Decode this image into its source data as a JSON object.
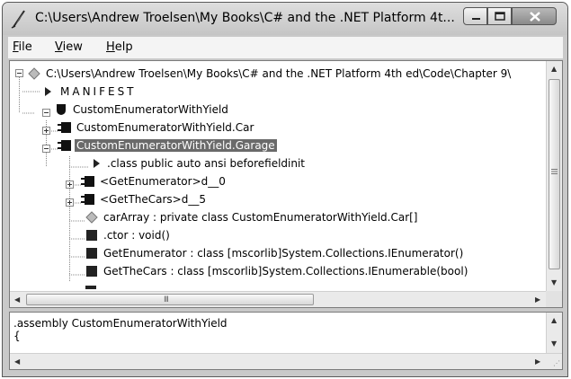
{
  "window": {
    "title": "C:\\Users\\Andrew Troelsen\\My Books\\C# and the .NET Platform 4t..."
  },
  "menu": {
    "file": "File",
    "view": "View",
    "help": "Help"
  },
  "tree": {
    "nodes": [
      {
        "label": "C:\\Users\\Andrew Troelsen\\My Books\\C# and the .NET Platform 4th ed\\Code\\Chapter 9\\",
        "icon": "assembly-diamond-icon"
      },
      {
        "label": "MANIFEST",
        "icon": "manifest-triangle-icon"
      },
      {
        "label": "CustomEnumeratorWithYield",
        "icon": "namespace-shield-icon"
      },
      {
        "label": "CustomEnumeratorWithYield.Car",
        "icon": "class-icon"
      },
      {
        "label": "CustomEnumeratorWithYield.Garage",
        "icon": "class-icon"
      },
      {
        "label": ".class public auto ansi beforefieldinit",
        "icon": "info-triangle-icon"
      },
      {
        "label": "<GetEnumerator>d__0",
        "icon": "class-icon"
      },
      {
        "label": "<GetTheCars>d__5",
        "icon": "class-icon"
      },
      {
        "label": "carArray : private class CustomEnumeratorWithYield.Car[]",
        "icon": "field-diamond-icon"
      },
      {
        "label": ".ctor : void()",
        "icon": "method-square-icon"
      },
      {
        "label": "GetEnumerator : class [mscorlib]System.Collections.IEnumerator()",
        "icon": "method-square-icon"
      },
      {
        "label": "GetTheCars : class [mscorlib]System.Collections.IEnumerable(bool)",
        "icon": "method-square-icon"
      }
    ]
  },
  "scroll": {
    "grip_label": "III"
  },
  "code": {
    "lines": [
      ".assembly CustomEnumeratorWithYield",
      "{"
    ]
  }
}
